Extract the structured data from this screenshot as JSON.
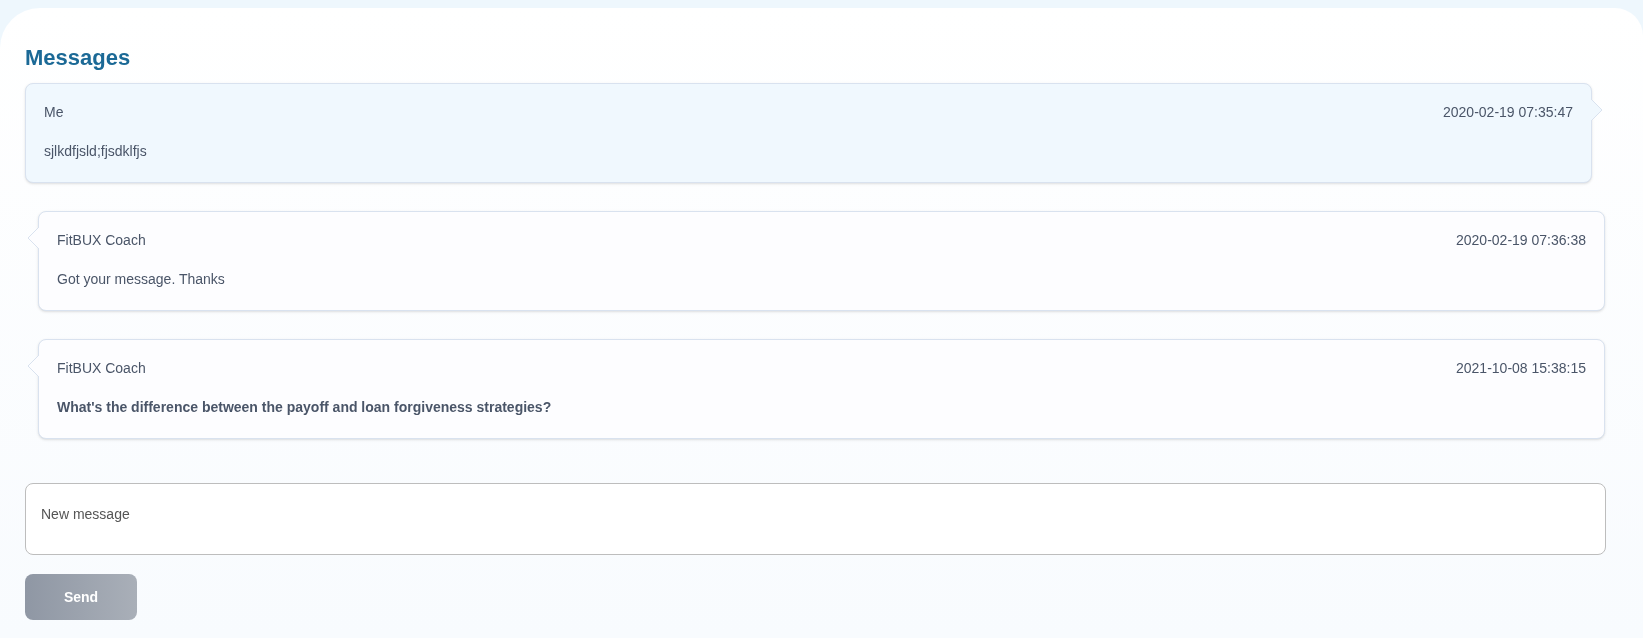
{
  "title": "Messages",
  "messages": [
    {
      "sender": "Me",
      "time": "2020-02-19 07:35:47",
      "text": "sjlkdfjsld;fjsdklfjs",
      "from_me": true,
      "bold": false
    },
    {
      "sender": "FitBUX Coach",
      "time": "2020-02-19 07:36:38",
      "text": "Got your message. Thanks",
      "from_me": false,
      "bold": false
    },
    {
      "sender": "FitBUX Coach",
      "time": "2021-10-08 15:38:15",
      "text": "What's the difference between the payoff and loan forgiveness strategies?",
      "from_me": false,
      "bold": true
    }
  ],
  "composer": {
    "placeholder": "New message"
  },
  "send_button": {
    "label": "Send",
    "disabled": true
  }
}
